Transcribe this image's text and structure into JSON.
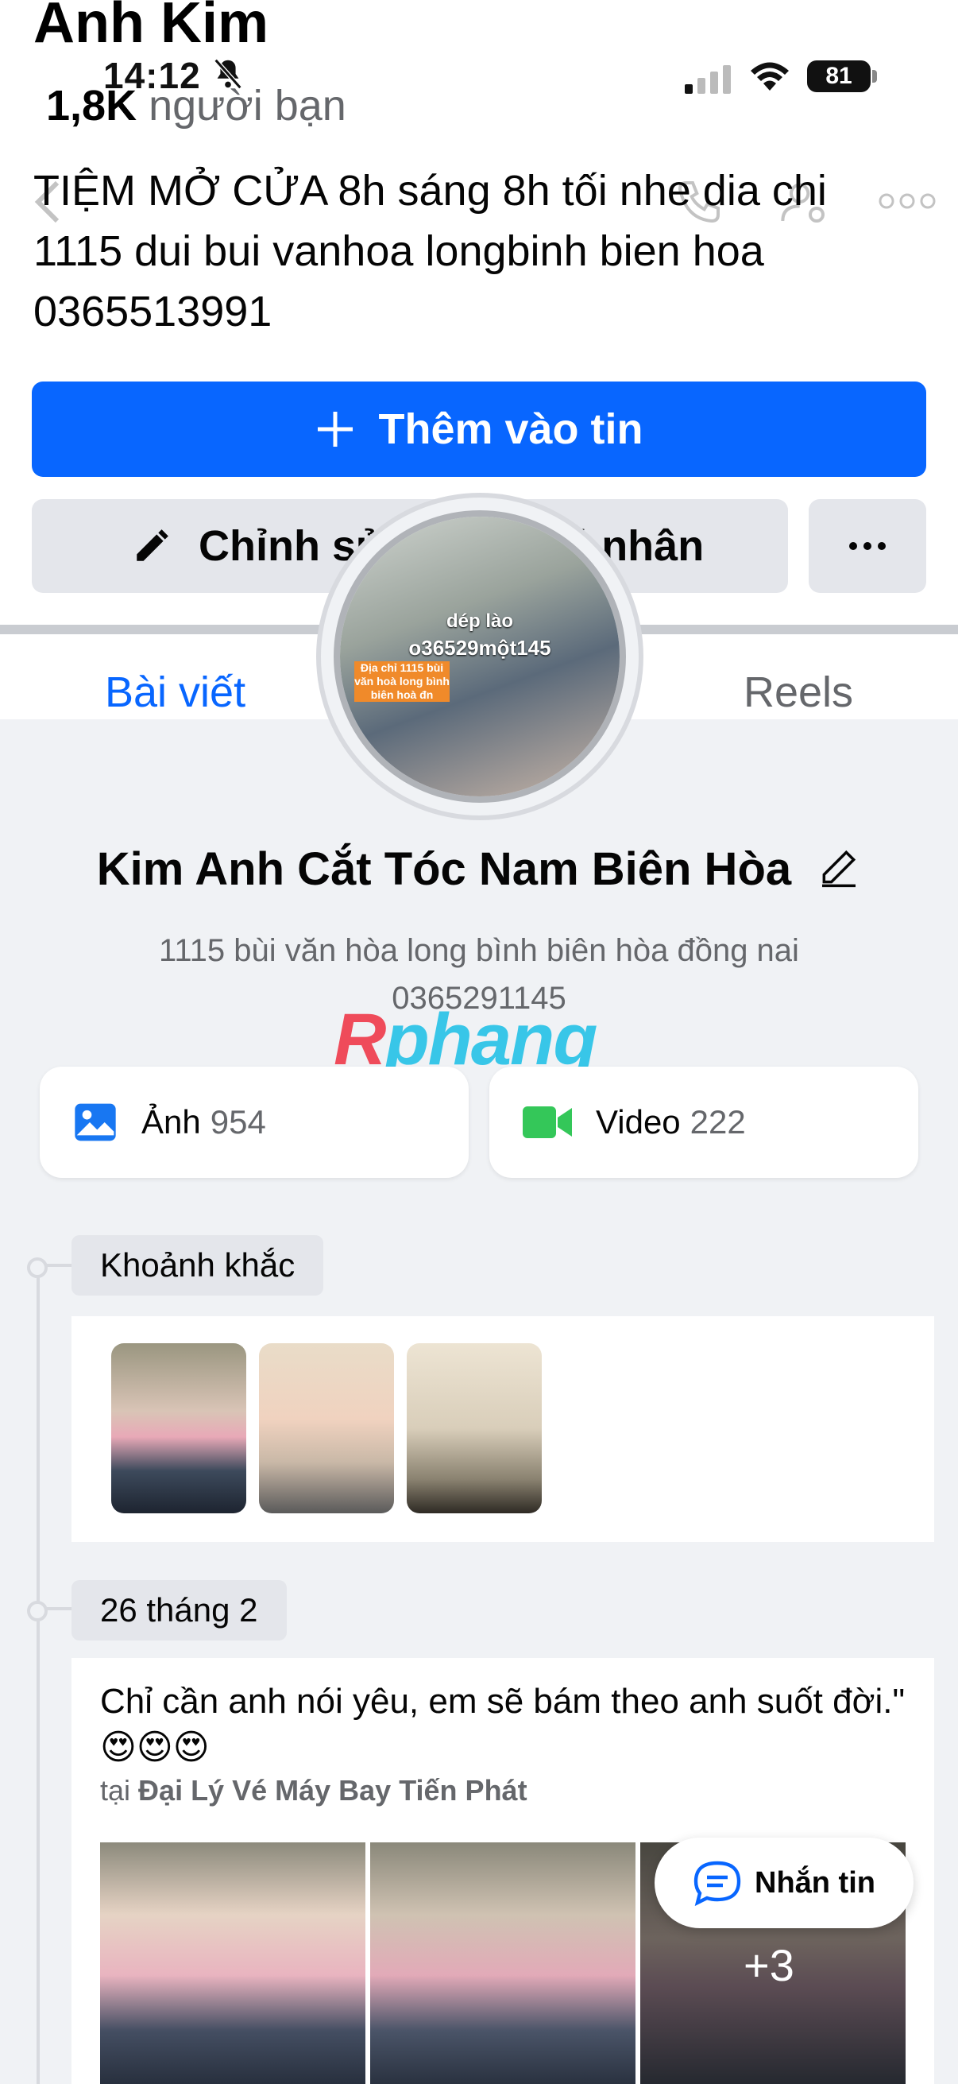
{
  "status_bar": {
    "time": "14:12",
    "battery": "81"
  },
  "profile": {
    "name_top": "Anh Kim",
    "friends_count": "1,8K",
    "friends_label": "người bạn",
    "bio": "TIỆM MỞ CỬA 8h sáng 8h tối nhe dia chi 1115 dui bui vanhoa longbinh bien hoa 0365513991",
    "add_story_label": "Thêm vào tin",
    "edit_profile_label": "Chỉnh sửa trang cá nhân"
  },
  "tabs": {
    "posts": "Bài viết",
    "reels": "Reels"
  },
  "avatar": {
    "line1": "dép lào",
    "line2": "o36529một145",
    "line3": "Địa chỉ 1115 bùi văn hoà long bình biên hoà đn"
  },
  "page": {
    "name": "Kim Anh Cắt Tóc Nam Biên Hòa",
    "address_line1": "1115 bùi văn hòa long bình biên hòa đồng nai",
    "address_line2": "0365291145"
  },
  "watermark": {
    "first": "R",
    "rest": "phang"
  },
  "media": {
    "photos_label": "Ảnh",
    "photos_count": "954",
    "videos_label": "Video",
    "videos_count": "222"
  },
  "timeline": {
    "moments_label": "Khoảnh khắc",
    "date_label": "26 tháng 2"
  },
  "post": {
    "text": "Chỉ cần anh nói yêu, em sẽ bám theo anh suốt đời.\"",
    "emojis": "😍😍😍",
    "location_prefix": "tại",
    "location_name": "Đại Lý Vé Máy Bay Tiến Phát",
    "more_photos": "+3"
  },
  "message_button": {
    "label": "Nhắn tin"
  },
  "colors": {
    "accent": "#0866ff",
    "video_green": "#34c759"
  }
}
